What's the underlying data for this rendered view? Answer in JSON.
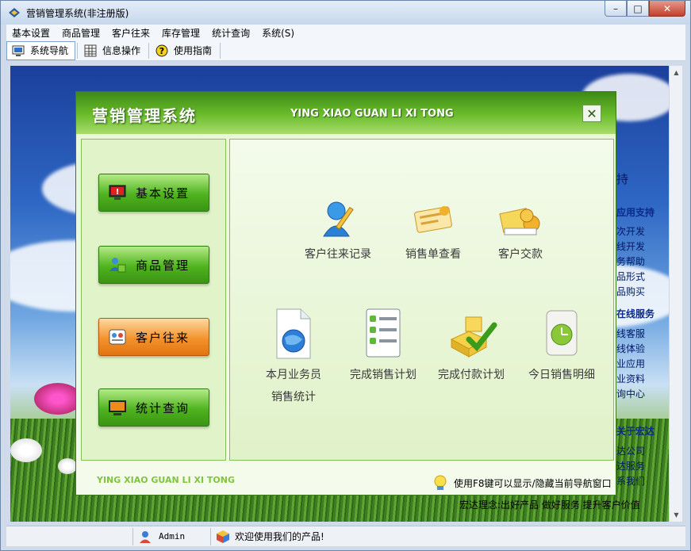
{
  "window": {
    "title": "营销管理系统(非注册版)",
    "min_label": "–",
    "max_label": "□",
    "close_label": "✕"
  },
  "menu": [
    "基本设置",
    "商品管理",
    "客户往来",
    "库存管理",
    "统计查询",
    "系统(S)"
  ],
  "toolbar": [
    {
      "label": "系统导航",
      "icon": "monitor-icon",
      "active": true
    },
    {
      "label": "信息操作",
      "icon": "grid-icon",
      "active": false
    },
    {
      "label": "使用指南",
      "icon": "help-icon",
      "active": false
    }
  ],
  "sidebar_bg": {
    "fragment_1": "持",
    "head_1": "应用支持",
    "items_1": [
      "次开发",
      "线开发",
      "务帮助",
      "品形式",
      "品购买"
    ],
    "head_2": "在线服务",
    "items_2": [
      "线客服",
      "线体验",
      "业应用",
      "业资料",
      "询中心"
    ],
    "head_3": "关于宏达",
    "items_3": [
      "达公司",
      "达服务",
      "系我们"
    ],
    "slogan": "宏达理念:出好产品 做好服务 提升客户价值"
  },
  "dialog": {
    "title": "营销管理系统",
    "pinyin": "YING XIAO GUAN LI XI TONG",
    "close": "✕",
    "nav": [
      {
        "label": "基本设置",
        "icon": "settings-icon",
        "selected": false
      },
      {
        "label": "商品管理",
        "icon": "goods-icon",
        "selected": false
      },
      {
        "label": "客户往来",
        "icon": "contacts-icon",
        "selected": true
      },
      {
        "label": "统计查询",
        "icon": "statistics-icon",
        "selected": false
      }
    ],
    "tiles": [
      {
        "label": "客户往来记录",
        "icon": "customer-record-icon"
      },
      {
        "label": "销售单查看",
        "icon": "sales-order-icon"
      },
      {
        "label": "客户交款",
        "icon": "customer-payment-icon"
      },
      {
        "label": "本月业务员",
        "label2": "销售统计",
        "icon": "globe-document-icon"
      },
      {
        "label": "完成销售计划",
        "icon": "checklist-icon"
      },
      {
        "label": "完成付款计划",
        "icon": "payment-done-icon"
      },
      {
        "label": "今日销售明细",
        "icon": "clock-icon"
      }
    ],
    "footer_pinyin": "YING XIAO GUAN LI XI TONG",
    "footer_hint": "使用F8键可以显示/隐藏当前导航窗口"
  },
  "status": {
    "user": "Admin",
    "message": "欢迎使用我们的产品!"
  }
}
